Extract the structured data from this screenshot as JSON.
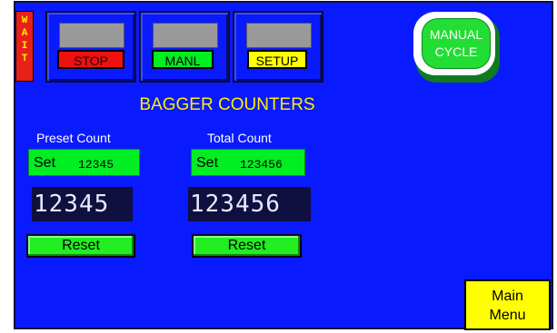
{
  "status": {
    "wait_letters": [
      "W",
      "A",
      "I",
      "T"
    ],
    "wait_color": "#e8201b"
  },
  "modes": [
    {
      "label": "STOP",
      "color": "#ee1111"
    },
    {
      "label": "MANL",
      "color": "#00ee22"
    },
    {
      "label": "SETUP",
      "color": "#ffff00"
    }
  ],
  "cycle_button": {
    "line1": "MANUAL",
    "line2": "CYCLE",
    "color": "#22dd33"
  },
  "title": "BAGGER COUNTERS",
  "preset": {
    "caption": "Preset Count",
    "set_label": "Set",
    "set_value": "12345",
    "display": "12345",
    "reset_label": "Reset"
  },
  "total": {
    "caption": "Total Count",
    "set_label": "Set",
    "set_value": "123456",
    "display": "123456",
    "reset_label": "Reset"
  },
  "main_menu": {
    "line1": "Main",
    "line2": "Menu"
  },
  "colors": {
    "background": "#0a1aff",
    "accent": "#ffee00",
    "button_green": "#22ee22"
  }
}
